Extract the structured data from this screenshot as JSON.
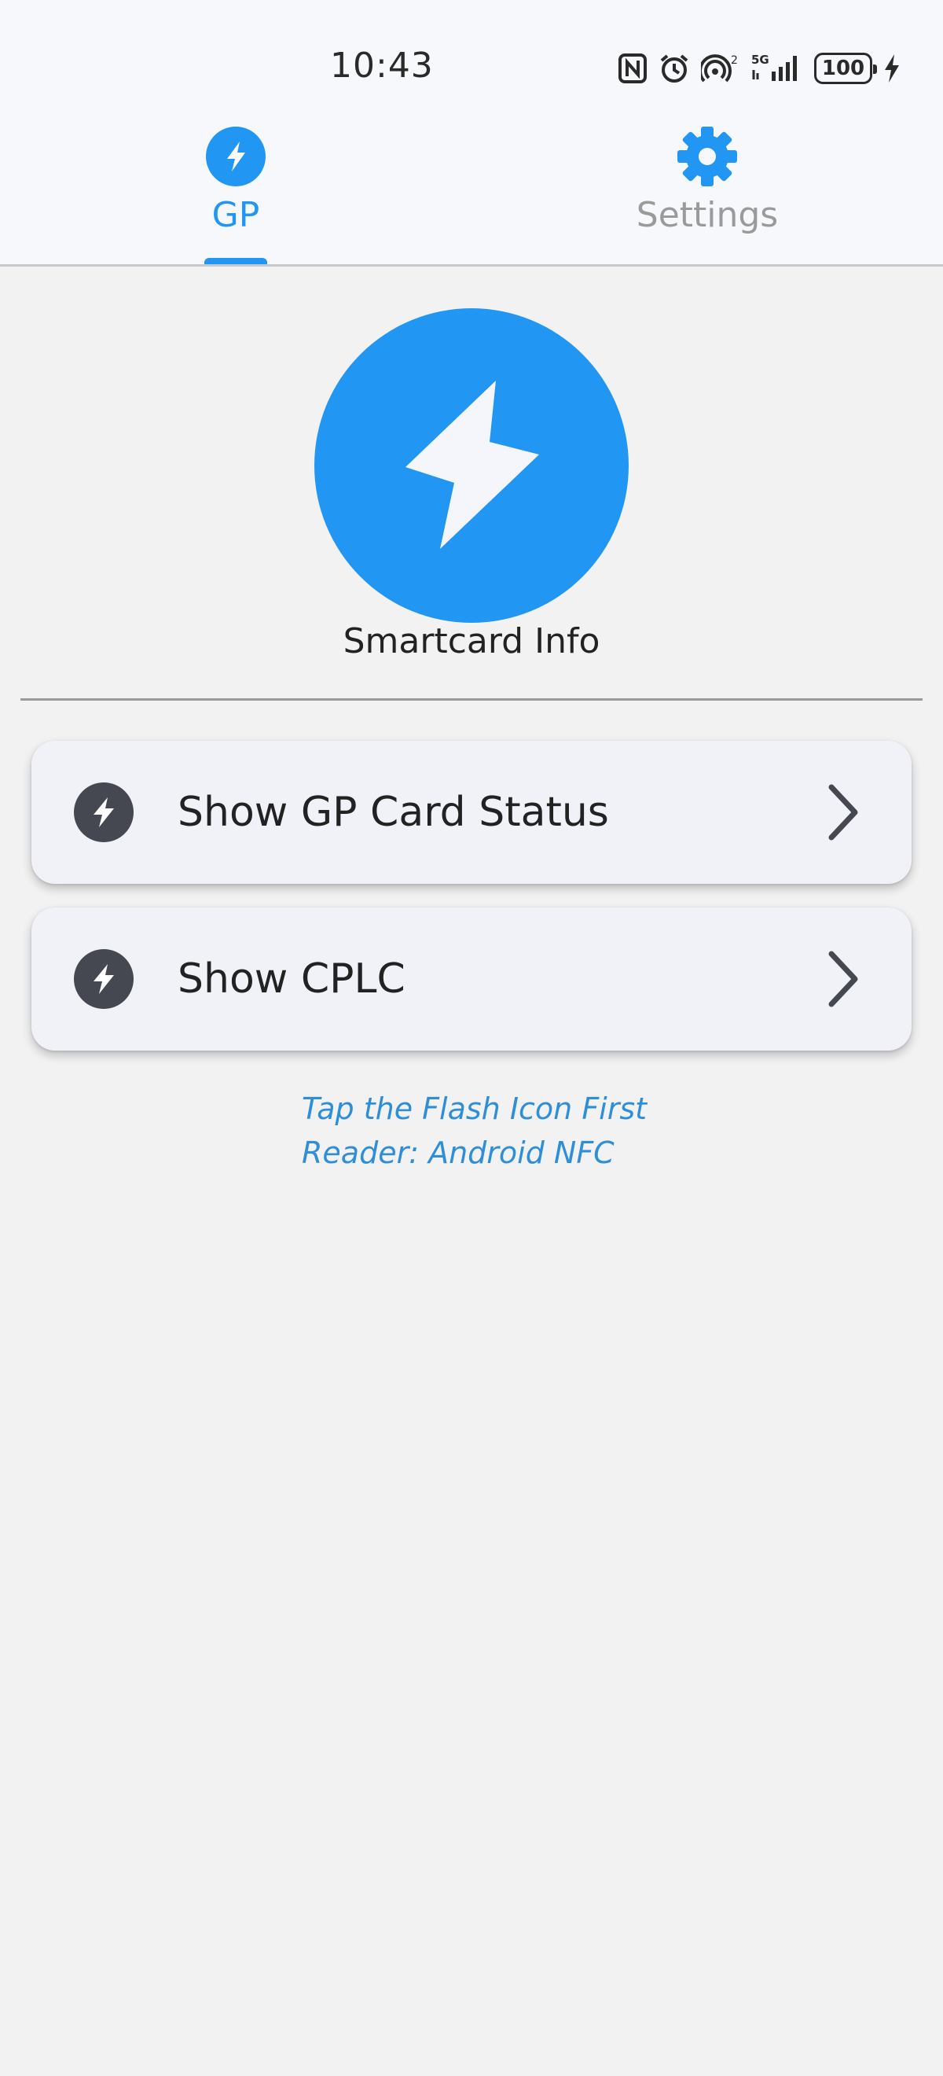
{
  "status_bar": {
    "time": "10:43",
    "network_label": "5G",
    "hotspot_count": "2",
    "battery_level": "100"
  },
  "tabs": [
    {
      "label": "GP",
      "icon": "flash-icon",
      "active": true
    },
    {
      "label": "Settings",
      "icon": "gear-icon",
      "active": false
    }
  ],
  "hero": {
    "title": "Smartcard Info",
    "icon": "flash-icon"
  },
  "menu": [
    {
      "label": "Show GP Card Status",
      "icon": "flash-icon",
      "trailing": "chevron-right-icon"
    },
    {
      "label": "Show CPLC",
      "icon": "flash-icon",
      "trailing": "chevron-right-icon"
    }
  ],
  "hints": {
    "line1": "Tap the Flash Icon First",
    "line2": "Reader: Android NFC"
  },
  "colors": {
    "accent": "#2196f3",
    "hint_text": "#2e8ed8",
    "card_bg": "#f1f2f8",
    "icon_dark": "#454850"
  }
}
